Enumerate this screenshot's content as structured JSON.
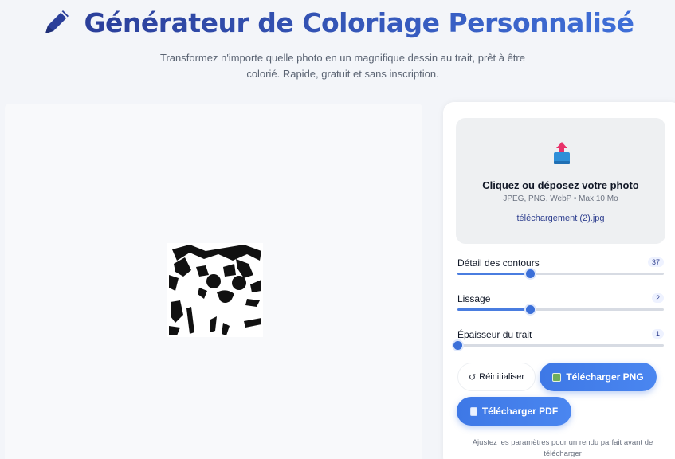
{
  "header": {
    "title": "Générateur de Coloriage Personnalisé",
    "title_icon": "pencil-icon",
    "subtitle": "Transformez n'importe quelle photo en un magnifique dessin au trait, prêt à être colorié. Rapide, gratuit et sans inscription."
  },
  "upload": {
    "icon": "upload-icon",
    "title": "Cliquez ou déposez votre photo",
    "hint": "JPEG, PNG, WebP • Max 10 Mo",
    "file_name": "téléchargement (2).jpg"
  },
  "sliders": [
    {
      "label": "Détail des contours",
      "value": "37",
      "fill_fraction": 0.35
    },
    {
      "label": "Lissage",
      "value": "2",
      "fill_fraction": 0.35
    },
    {
      "label": "Épaisseur du trait",
      "value": "1",
      "fill_fraction": 0.0
    }
  ],
  "buttons": {
    "reset_label": "Réinitialiser",
    "reset_icon": "refresh-icon",
    "png_label": "Télécharger PNG",
    "png_icon": "image-icon",
    "pdf_label": "Télécharger PDF",
    "pdf_icon": "document-icon"
  },
  "footnote": "Ajustez les paramètres pour un rendu parfait avant de télécharger",
  "colors": {
    "accent": "#3e78e6",
    "title_gradient_start": "#2b3f9a",
    "title_gradient_end": "#3f6fd8",
    "background": "#f3f5f9"
  }
}
